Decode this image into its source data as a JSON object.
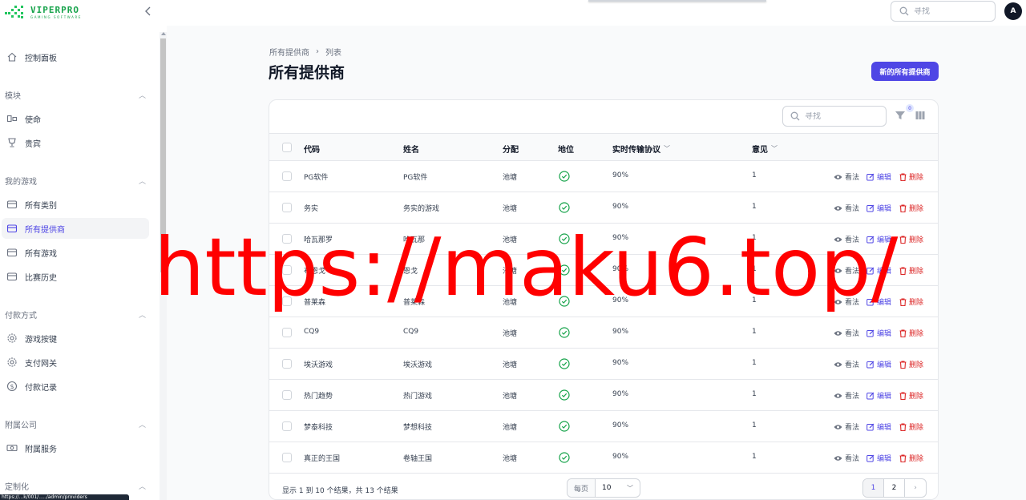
{
  "brand": {
    "name": "VIPERPRO",
    "tagline": "GAMING SOFTWARE"
  },
  "topbar": {
    "search_placeholder": "寻找",
    "avatar_initial": "A"
  },
  "sidebar": {
    "items_top": [
      {
        "label": "控制面板",
        "icon": "home-icon"
      }
    ],
    "groups": [
      {
        "label": "模块",
        "items": [
          {
            "label": "使命",
            "icon": "mission-icon"
          },
          {
            "label": "贵宾",
            "icon": "trophy-icon"
          }
        ]
      },
      {
        "label": "我的游戏",
        "items": [
          {
            "label": "所有类别",
            "icon": "folder-icon"
          },
          {
            "label": "所有提供商",
            "icon": "folder-icon",
            "active": true
          },
          {
            "label": "所有游戏",
            "icon": "folder-icon"
          },
          {
            "label": "比赛历史",
            "icon": "folder-icon"
          }
        ]
      },
      {
        "label": "付款方式",
        "items": [
          {
            "label": "游戏按键",
            "icon": "gear-icon"
          },
          {
            "label": "支付网关",
            "icon": "gear-icon"
          },
          {
            "label": "付款记录",
            "icon": "dollar-icon"
          }
        ]
      },
      {
        "label": "附属公司",
        "items": [
          {
            "label": "附属服务",
            "icon": "money-icon"
          }
        ]
      },
      {
        "label": "定制化",
        "items": []
      }
    ]
  },
  "status_url": "https://...k/001/...../admin/providers",
  "main": {
    "breadcrumb": [
      "所有提供商",
      "列表"
    ],
    "title": "所有提供商",
    "new_button": "新的所有提供商",
    "table_search_placeholder": "寻找",
    "filter_count": "0",
    "columns": [
      "代码",
      "姓名",
      "分配",
      "地位",
      "实时传输协议",
      "意见"
    ],
    "rows": [
      {
        "code": "PG软件",
        "name": "PG软件",
        "dist": "池塘",
        "rtp": "90%",
        "views": "1"
      },
      {
        "code": "务实",
        "name": "务实的游戏",
        "dist": "池塘",
        "rtp": "90%",
        "views": "1"
      },
      {
        "code": "哈瓦那罗",
        "name": "哈瓦那",
        "dist": "池塘",
        "rtp": "90%",
        "views": "1"
      },
      {
        "code": "布恩戈",
        "name": "恩戈",
        "dist": "池塘",
        "rtp": "90%",
        "views": "1"
      },
      {
        "code": "普莱森",
        "name": "普莱森",
        "dist": "池塘",
        "rtp": "90%",
        "views": "1"
      },
      {
        "code": "CQ9",
        "name": "CQ9",
        "dist": "池塘",
        "rtp": "90%",
        "views": "1"
      },
      {
        "code": "埃沃游戏",
        "name": "埃沃游戏",
        "dist": "池塘",
        "rtp": "90%",
        "views": "1"
      },
      {
        "code": "热门趋势",
        "name": "热门游戏",
        "dist": "池塘",
        "rtp": "90%",
        "views": "1"
      },
      {
        "code": "梦泰科技",
        "name": "梦想科技",
        "dist": "池塘",
        "rtp": "90%",
        "views": "1"
      },
      {
        "code": "真正的王国",
        "name": "卷轴王国",
        "dist": "池塘",
        "rtp": "90%",
        "views": "1"
      }
    ],
    "actions": {
      "view": "看法",
      "edit": "编辑",
      "delete": "删除"
    },
    "footer": {
      "summary": "显示 1 到 10 个结果，共 13 个结果",
      "per_page_label": "每页",
      "per_page_value": "10",
      "pages": [
        "1",
        "2"
      ]
    }
  },
  "watermark": "https://maku6.top/",
  "colors": {
    "accent": "#4f46e5",
    "brand_green": "#16a34a",
    "danger": "#dc2626",
    "success": "#16a34a",
    "watermark": "#ff0000"
  }
}
